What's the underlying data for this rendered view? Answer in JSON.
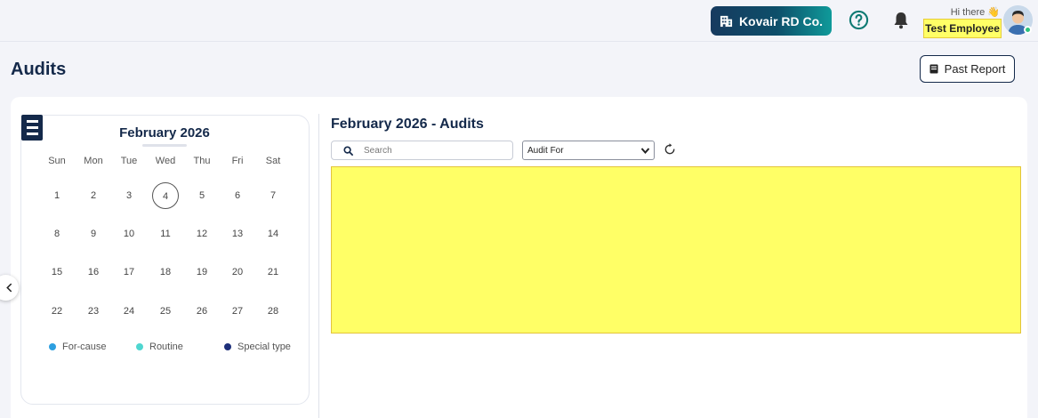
{
  "header": {
    "company": "Kovair RD Co.",
    "greeting": "Hi there",
    "greeting_emoji": "👋",
    "user_name": "Test Employee"
  },
  "page": {
    "title": "Audits",
    "past_report_label": "Past Report"
  },
  "calendar": {
    "month_title": "February 2026",
    "weekdays": [
      "Sun",
      "Mon",
      "Tue",
      "Wed",
      "Thu",
      "Fri",
      "Sat"
    ],
    "weeks": [
      [
        "1",
        "2",
        "3",
        "4",
        "5",
        "6",
        "7"
      ],
      [
        "8",
        "9",
        "10",
        "11",
        "12",
        "13",
        "14"
      ],
      [
        "15",
        "16",
        "17",
        "18",
        "19",
        "20",
        "21"
      ],
      [
        "22",
        "23",
        "24",
        "25",
        "26",
        "27",
        "28"
      ]
    ],
    "today": "4",
    "legend": [
      {
        "label": "For-cause",
        "color": "#2d9fe0"
      },
      {
        "label": "Routine",
        "color": "#4fd6d0"
      },
      {
        "label": "Special type",
        "color": "#1d2f7a"
      }
    ]
  },
  "audits_panel": {
    "title": "February 2026 - Audits",
    "search_placeholder": "Search",
    "filter_selected": "Audit For"
  },
  "colors": {
    "brand_navy": "#14294a",
    "highlight_yellow": "#ffff66",
    "online_green": "#2ec27e"
  },
  "icons": [
    "building-icon",
    "help-icon",
    "bell-icon",
    "wave-icon",
    "avatar",
    "report-icon",
    "menu-icon",
    "chevron-left-icon",
    "search-icon",
    "chevron-down-icon",
    "refresh-icon"
  ]
}
